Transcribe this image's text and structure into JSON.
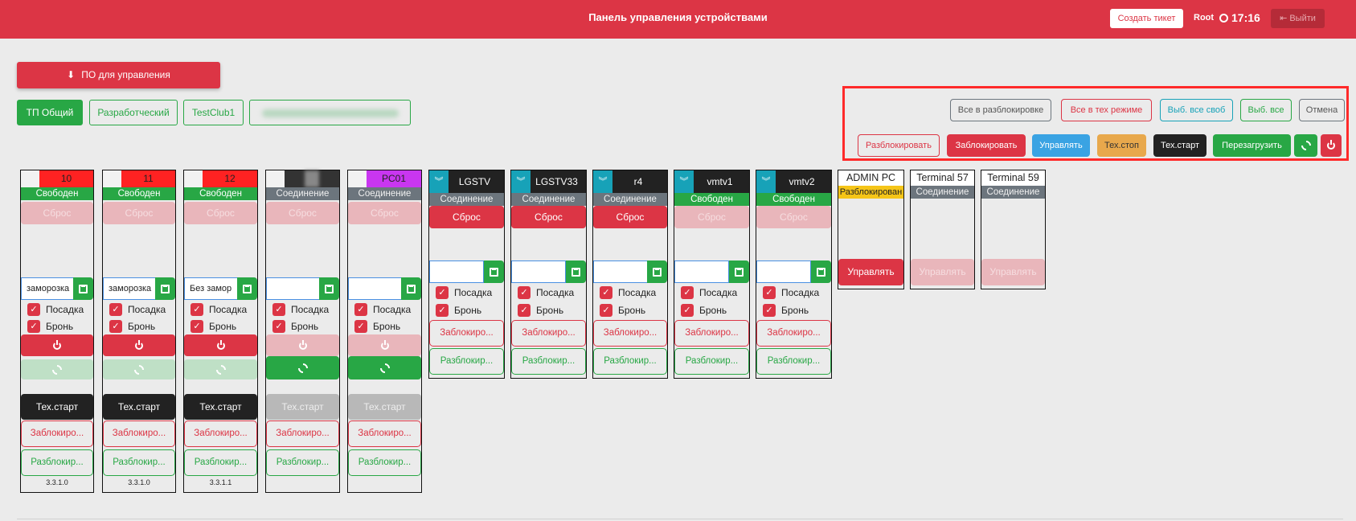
{
  "header": {
    "title": "Панель управления устройствами",
    "ticket_button": "Создать тикет",
    "user": "Root",
    "time": "17:16",
    "logout": "Выйти"
  },
  "po_button": "ПО для управления",
  "clubs": [
    {
      "label": "ТП Общий",
      "active": true
    },
    {
      "label": "Разработческий",
      "active": false
    },
    {
      "label": "TestClub1",
      "active": false
    },
    {
      "label": "",
      "active": false
    }
  ],
  "bulk": {
    "row1": [
      "Все в разблокировке",
      "Все в тех режиме",
      "Выб. все своб",
      "Выб. все",
      "Отмена"
    ],
    "row2": [
      "Разблокировать",
      "Заблокировать",
      "Управлять",
      "Тех.стоп",
      "Тех.старт",
      "Перезагрузить"
    ]
  },
  "labels": {
    "reset": "Сброс",
    "landing": "Посадка",
    "booking": "Бронь",
    "tech_start": "Тех.старт",
    "block": "Заблокиро...",
    "unblock": "Разблокир...",
    "manage": "Управлять"
  },
  "pcs": [
    {
      "name": "10",
      "status": "Свободен",
      "field": "заморозка",
      "version": "3.3.1.0"
    },
    {
      "name": "11",
      "status": "Свободен",
      "field": "заморозка",
      "version": "3.3.1.0"
    },
    {
      "name": "12",
      "status": "Свободен",
      "field": "Без замор",
      "version": "3.3.1.1"
    },
    {
      "name": "",
      "status": "Соединение",
      "field": "",
      "version": ""
    },
    {
      "name": "PC01",
      "status": "Соединение",
      "field": "",
      "version": ""
    }
  ],
  "tvs": [
    {
      "name": "LGSTV",
      "status": "Соединение"
    },
    {
      "name": "LGSTV33",
      "status": "Соединение"
    },
    {
      "name": "r4",
      "status": "Соединение"
    },
    {
      "name": "vmtv1",
      "status": "Свободен"
    },
    {
      "name": "vmtv2",
      "status": "Свободен"
    }
  ],
  "admins": [
    {
      "name": "ADMIN PC",
      "status": "Разблокирован"
    },
    {
      "name": "Terminal 57",
      "status": "Соединение"
    },
    {
      "name": "Terminal 59",
      "status": "Соединение"
    }
  ],
  "colors": {
    "red": "#dc3545",
    "green": "#28a745",
    "teal": "#17a2b8",
    "gray": "#6c757d",
    "blue": "#3aa3e3",
    "orange": "#e8a84c",
    "dark": "#222222",
    "purple": "#c936f0",
    "yellow": "#f5c518"
  }
}
